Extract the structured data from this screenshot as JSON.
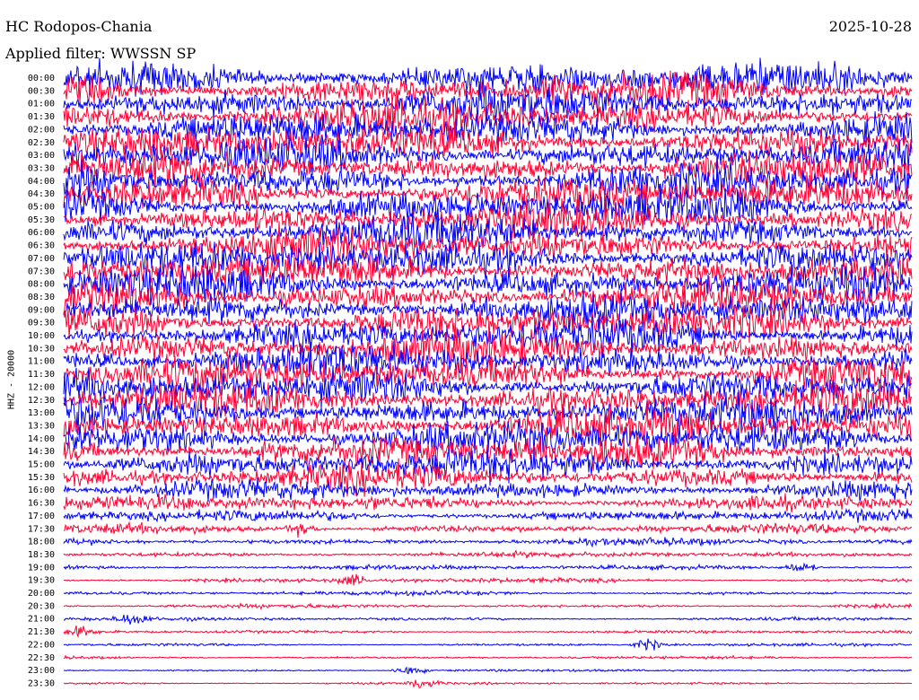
{
  "header": {
    "station": "HC Rodopos-Chania",
    "date": "2025-10-28",
    "filter": "Applied filter: WWSSN SP"
  },
  "ylabel": "HHZ - 20000",
  "colors": {
    "odd": "#0000ff",
    "even": "#ff0033",
    "text": "#000000"
  },
  "chart_data": {
    "type": "line",
    "title": "HC Rodopos-Chania",
    "ylabel": "HHZ - 20000",
    "time_labels": [
      "00:00",
      "00:30",
      "01:00",
      "01:30",
      "02:00",
      "02:30",
      "03:00",
      "03:30",
      "04:00",
      "04:30",
      "05:00",
      "05:30",
      "06:00",
      "06:30",
      "07:00",
      "07:30",
      "08:00",
      "08:30",
      "09:00",
      "09:30",
      "10:00",
      "10:30",
      "11:00",
      "11:30",
      "12:00",
      "12:30",
      "13:00",
      "13:30",
      "14:00",
      "14:30",
      "15:00",
      "15:30",
      "16:00",
      "16:30",
      "17:00",
      "17:30",
      "18:00",
      "18:30",
      "19:00",
      "19:30",
      "20:00",
      "20:30",
      "21:00",
      "21:30",
      "22:00",
      "22:30",
      "23:00",
      "23:30"
    ],
    "trace_colors": [
      "#0000ff",
      "#ff0033"
    ],
    "noise_level": [
      1.0,
      1.0,
      1.0,
      1.0,
      1.0,
      1.0,
      1.0,
      1.0,
      1.0,
      1.0,
      1.0,
      1.0,
      1.0,
      1.0,
      1.0,
      1.0,
      1.0,
      1.0,
      1.0,
      1.0,
      1.0,
      1.0,
      1.0,
      1.0,
      1.0,
      1.0,
      1.0,
      1.0,
      1.0,
      0.95,
      0.85,
      0.75,
      0.55,
      0.45,
      0.35,
      0.28,
      0.2,
      0.16,
      0.14,
      0.13,
      0.12,
      0.11,
      0.1,
      0.09,
      0.08,
      0.08,
      0.07,
      0.07
    ]
  }
}
